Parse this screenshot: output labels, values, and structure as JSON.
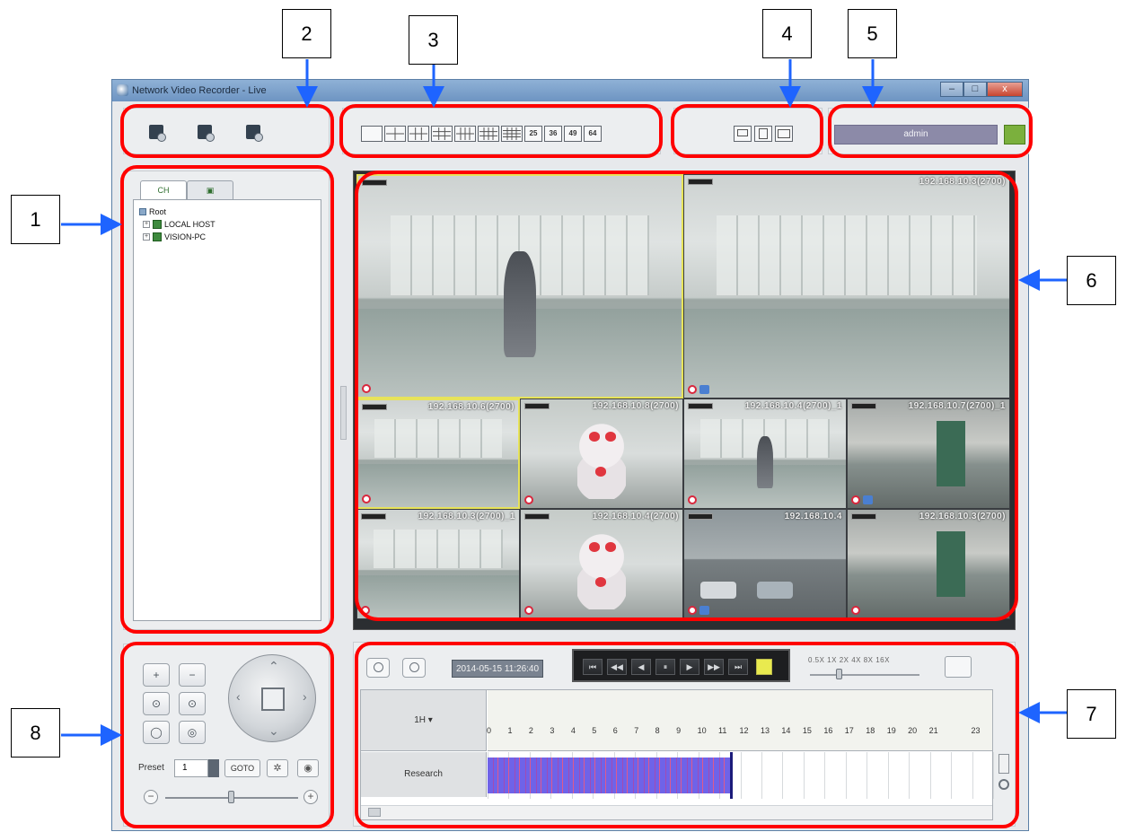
{
  "callouts": [
    "1",
    "2",
    "3",
    "4",
    "5",
    "6",
    "7",
    "8"
  ],
  "window": {
    "title": "Network Video Recorder - Live",
    "minimize": "–",
    "maximize": "□",
    "close": "x"
  },
  "icons": {
    "record_tools": [
      "camera-snapshot-icon",
      "clock-settings-icon",
      "monitor-settings-icon"
    ],
    "layout_buttons": [
      "1",
      "4",
      "6",
      "9",
      "8",
      "10",
      "16",
      "25",
      "36",
      "49",
      "64"
    ],
    "layout_labels": [
      "25",
      "36",
      "49",
      "64"
    ],
    "display_buttons": [
      "fullscreen-icon",
      "save-icon",
      "sequence-icon"
    ]
  },
  "user": {
    "name": "admin"
  },
  "tree": {
    "tabs": [
      "CH",
      "▣"
    ],
    "root": "Root",
    "nodes": [
      "LOCAL HOST",
      "VISION-PC"
    ],
    "expanders": [
      "+",
      "+"
    ]
  },
  "cameras": [
    {
      "label": "",
      "scene": "office"
    },
    {
      "label": "192.168.10.3(2700)",
      "scene": "office"
    },
    {
      "label": "192.168.10.6(2700)",
      "scene": "office"
    },
    {
      "label": "192.168.10.8(2700)",
      "scene": "doll"
    },
    {
      "label": "192.168.10.4(2700)_1",
      "scene": "office"
    },
    {
      "label": "192.168.10.7(2700)_1",
      "scene": "hall"
    },
    {
      "label": "192.168.10.3(2700)_1",
      "scene": "office"
    },
    {
      "label": "192.168.10.4(2700)",
      "scene": "doll"
    },
    {
      "label": "192.168.10.4",
      "scene": "parking"
    },
    {
      "label": "192.168.10.3(2700)",
      "scene": "hall"
    }
  ],
  "playback": {
    "datetime": "2014-05-15 11:26:40",
    "controls": [
      "⏮",
      "◀◀",
      "◀",
      "⏸",
      "▶",
      "▶▶",
      "⏭"
    ],
    "speeds": "0.5X 1X 2X 4X 8X 16X"
  },
  "timeline": {
    "zoom_label": "1H ▾",
    "track_name": "Research",
    "hours": [
      "0",
      "1",
      "2",
      "3",
      "4",
      "5",
      "6",
      "7",
      "8",
      "9",
      "10",
      "11",
      "12",
      "13",
      "14",
      "15",
      "16",
      "17",
      "18",
      "19",
      "20",
      "21",
      "23"
    ],
    "recorded_fraction": 0.48
  },
  "ptz": {
    "zoom_in": "+",
    "zoom_out": "−",
    "focus_near": "⊙",
    "focus_far": "⊙",
    "iris_open": "◯",
    "iris_close": "◎",
    "preset_label": "Preset",
    "preset_value": "1",
    "goto_label": "GOTO",
    "settings_icon": "✲",
    "delete_icon": "◉",
    "zoom_minus": "−",
    "zoom_plus": "+"
  },
  "colors": {
    "callout_frame": "#ff0000",
    "arrow": "#1e64ff",
    "selected_cam": "#e7e35a",
    "record_bar": "#6f63e8"
  }
}
